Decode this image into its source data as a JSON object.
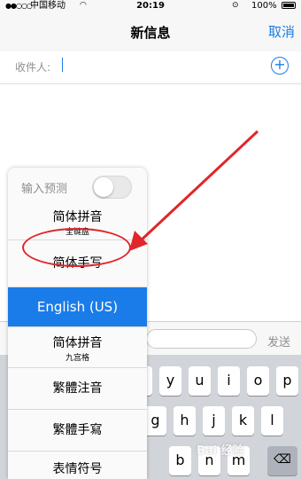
{
  "status_bar": {
    "signal": "●●○○○",
    "carrier": "中国移动",
    "wifi_icon": "wifi-icon",
    "time": "20:19",
    "lock_icon": "rotation-lock-icon",
    "battery": "100%"
  },
  "nav": {
    "title": "新信息",
    "cancel": "取消"
  },
  "recipient": {
    "label": "收件人:",
    "add_icon": "plus-circle-icon"
  },
  "compose": {
    "send": "发送"
  },
  "keyboard_keys": {
    "row1": [
      "t",
      "y",
      "u",
      "i",
      "o",
      "p"
    ],
    "row2": [
      "g",
      "h",
      "j",
      "k",
      "l"
    ],
    "row3": [
      "b",
      "n",
      "m"
    ],
    "delete_icon": "backspace-icon",
    "shift_icon": "shift-icon"
  },
  "popup": {
    "predict_label": "输入预测",
    "predict_on": false,
    "items": [
      {
        "main": "简体拼音",
        "sub": "全键盘"
      },
      {
        "main": "简体手写",
        "sub": ""
      },
      {
        "main": "English (US)",
        "sub": ""
      },
      {
        "main": "简体拼音",
        "sub": "九宫格"
      },
      {
        "main": "繁體注音",
        "sub": ""
      },
      {
        "main": "繁體手寫",
        "sub": ""
      },
      {
        "main": "表情符号",
        "sub": ""
      }
    ],
    "selected_index": 2
  },
  "watermark": "Bai 经验",
  "colors": {
    "accent": "#1a7ce8",
    "annotation": "#e0262a"
  }
}
